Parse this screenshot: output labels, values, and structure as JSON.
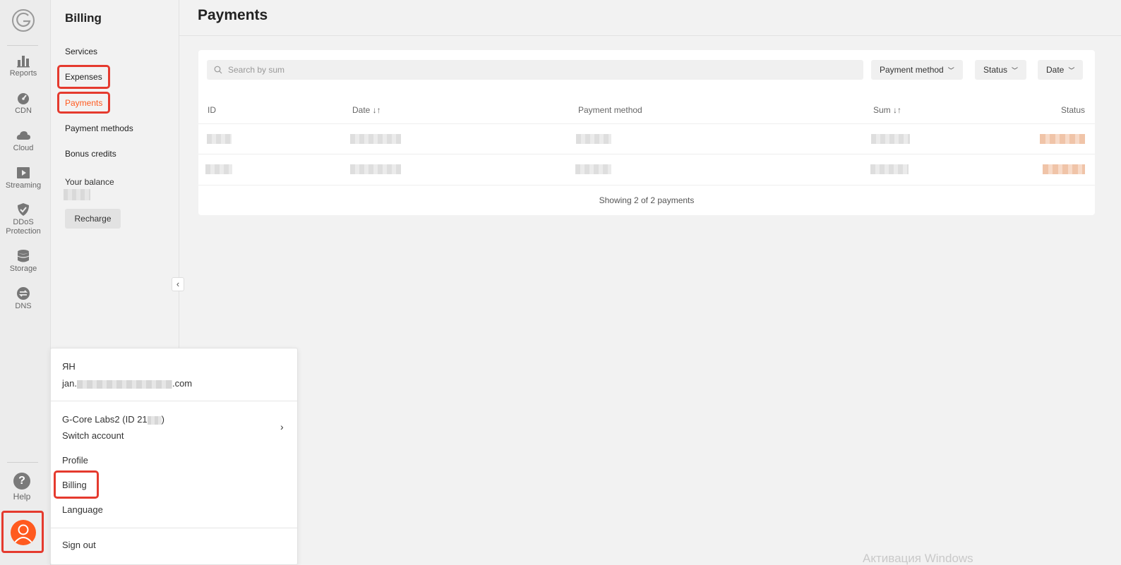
{
  "colors": {
    "accent": "#ff5a1f",
    "highlight": "#e53a2e",
    "status_pill": "#f0c4a8"
  },
  "rail": {
    "items": [
      {
        "label": "Reports",
        "icon": "bar-chart-icon"
      },
      {
        "label": "CDN",
        "icon": "speedometer-icon"
      },
      {
        "label": "Cloud",
        "icon": "cloud-icon"
      },
      {
        "label": "Streaming",
        "icon": "play-icon"
      },
      {
        "label": "DDoS Protection",
        "icon": "shield-check-icon"
      },
      {
        "label": "Storage",
        "icon": "database-icon"
      },
      {
        "label": "DNS",
        "icon": "exchange-icon"
      }
    ],
    "help": {
      "label": "Help",
      "glyph": "?"
    },
    "avatar_icon": "user-avatar-icon"
  },
  "sidebar": {
    "title": "Billing",
    "items": [
      {
        "label": "Services"
      },
      {
        "label": "Expenses"
      },
      {
        "label": "Payments"
      },
      {
        "label": "Payment methods"
      },
      {
        "label": "Bonus credits"
      }
    ],
    "balance_label": "Your balance",
    "recharge_label": "Recharge",
    "collapse_glyph": "‹"
  },
  "main": {
    "title": "Payments",
    "search_placeholder": "Search by sum",
    "filters": {
      "payment_method": "Payment method",
      "status": "Status",
      "date": "Date"
    },
    "columns": {
      "id": "ID",
      "date": "Date ↓↑",
      "method": "Payment method",
      "sum": "Sum ↓↑",
      "status": "Status"
    },
    "footer": "Showing 2 of 2 payments"
  },
  "dropdown": {
    "initials": "ЯН",
    "email_prefix": "jan.",
    "email_suffix": ".com",
    "account_name": "G-Core Labs2 (ID 21",
    "account_close": ")",
    "switch_account": "Switch account",
    "profile": "Profile",
    "billing": "Billing",
    "language": "Language",
    "sign_out": "Sign out",
    "chevron": "›"
  },
  "watermark": "Активация Windows"
}
